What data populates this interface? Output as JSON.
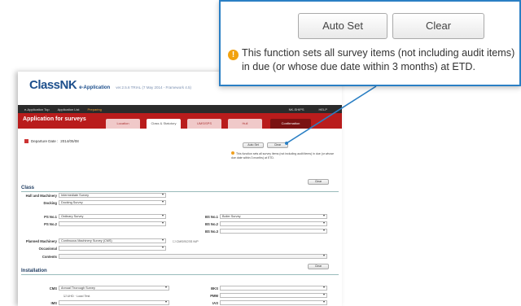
{
  "brand": {
    "logo": "ClassNK",
    "app_name": "e-Application",
    "version": "ver.2.5.6 TRIAL (7 May 2014 - Framework 4.5)"
  },
  "topnav": {
    "items": [
      "e-Application Top",
      "Application List",
      "Preparing"
    ],
    "right": [
      "NK-SHIPS",
      "HELP"
    ]
  },
  "header": {
    "title": "Application for surveys"
  },
  "tabs": [
    {
      "label": "Location"
    },
    {
      "label": "Class & Statutory"
    },
    {
      "label": "UMS/SPS"
    },
    {
      "label": "Hull"
    },
    {
      "label": "Confirmation"
    }
  ],
  "departure": {
    "label": "Departure Date :",
    "value": "2014/05/08"
  },
  "mini_buttons": {
    "auto_set": "Auto Set",
    "clear": "Clear"
  },
  "mini_info": "This function sets all survey items (not including audit items) in due (or whose due date within 3 months) at ETD.",
  "class_section": {
    "title": "Class",
    "clear": "Clear",
    "rows": [
      {
        "label": "Hull and Machinery",
        "value": "Intermediate Survey"
      },
      {
        "label": "Docking",
        "value": "Docking Survey"
      },
      {
        "label": "PS No.1",
        "value": "Ordinary Survey"
      },
      {
        "label": "PS No.2",
        "value": ""
      },
      {
        "label": "Planned Machinery",
        "value": "Continuous Machinery Survey (CMS)"
      },
      {
        "label": "Occasional",
        "value": ""
      },
      {
        "label": "Contents",
        "value": ""
      }
    ],
    "bs_rows": [
      {
        "label": "BS No.1",
        "value": "Boiler Survey"
      },
      {
        "label": "BS No.2",
        "value": ""
      },
      {
        "label": "BS No.3",
        "value": ""
      }
    ],
    "cms_checkbox": "CMS/SCSS N/P"
  },
  "installation_section": {
    "title": "Installation",
    "clear": "Clear",
    "rows": [
      {
        "label": "CMS",
        "value": "Annual Thorough Survey"
      },
      {
        "label": "",
        "value": "UHD · Load Test"
      },
      {
        "label": "IMS",
        "value": ""
      }
    ],
    "right_rows": [
      {
        "label": "BKS",
        "value": ""
      },
      {
        "label": "PMM",
        "value": ""
      },
      {
        "label": "IAS",
        "value": ""
      }
    ]
  },
  "callout": {
    "auto_set": "Auto Set",
    "clear": "Clear",
    "info_line1": "This function sets all survey items (not including audit items)",
    "info_line2": "in due (or whose due date within 3 months) at ETD."
  },
  "colors": {
    "accent_blue": "#2a7fc4",
    "header_red": "#b91c1c",
    "warning": "#f2a20f"
  }
}
